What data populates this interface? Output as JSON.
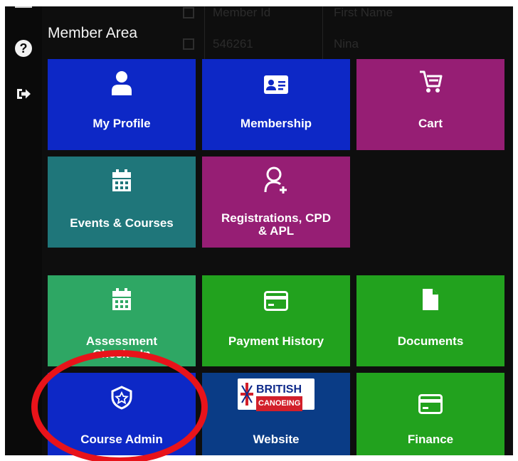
{
  "background_table": {
    "header": [
      "Member Id",
      "First Name"
    ],
    "row": [
      "546261",
      "Nina"
    ]
  },
  "rail": {
    "help_icon": "question-circle-icon",
    "logout_icon": "sign-out-icon"
  },
  "section_title": "Member Area",
  "tiles": {
    "my_profile": {
      "label": "My Profile",
      "icon": "user-icon",
      "color": "#0d28c6"
    },
    "membership": {
      "label": "Membership",
      "icon": "id-card-icon",
      "color": "#0d28c6"
    },
    "cart": {
      "label": "Cart",
      "icon": "cart-icon",
      "color": "#961e74"
    },
    "events_courses": {
      "label": "Events & Courses",
      "icon": "calendar-icon",
      "color": "#1f767a"
    },
    "registrations": {
      "label_line1": "Registrations, CPD",
      "label_line2": "& APL",
      "icon": "user-plus-icon",
      "color": "#961e74"
    },
    "assessment": {
      "label_line1": "Assessment",
      "label_line2": "Check - In",
      "icon": "calendar-icon",
      "color": "#2ea764"
    },
    "payment_history": {
      "label": "Payment History",
      "icon": "credit-card-icon",
      "color": "#22a21e"
    },
    "documents": {
      "label": "Documents",
      "icon": "file-icon",
      "color": "#22a21e"
    },
    "course_admin": {
      "label": "Course Admin",
      "icon": "shield-star-icon",
      "color": "#0d28c6"
    },
    "website": {
      "label": "Website",
      "logo_text_1": "BRITISH",
      "logo_text_2": "CANOEING",
      "color": "#0a3c86"
    },
    "finance": {
      "label": "Finance",
      "icon": "credit-card-icon",
      "color": "#22a21e"
    }
  },
  "annotation": {
    "shape": "ellipse",
    "color": "#e8131a"
  }
}
